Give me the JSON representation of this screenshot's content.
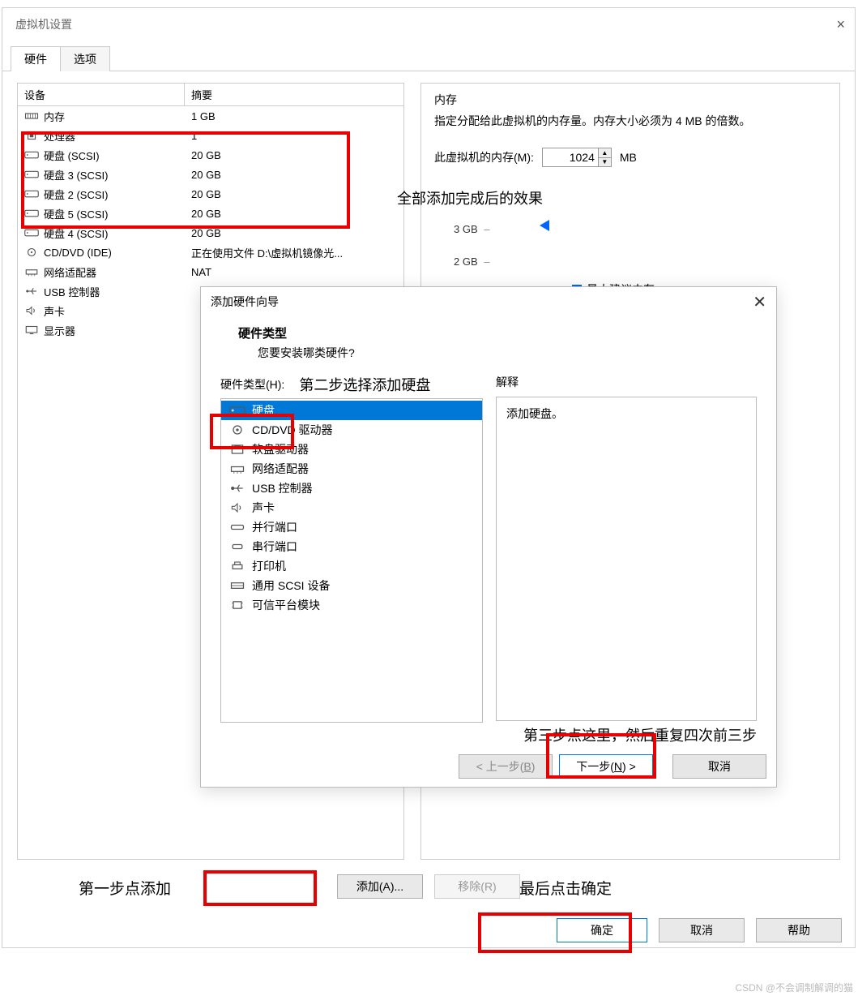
{
  "window": {
    "title": "虚拟机设置",
    "tabs": {
      "hardware": "硬件",
      "options": "选项"
    }
  },
  "devices": {
    "header": {
      "device": "设备",
      "summary": "摘要"
    },
    "rows": [
      {
        "name": "内存",
        "summary": "1 GB",
        "icon": "memory"
      },
      {
        "name": "处理器",
        "summary": "1",
        "icon": "cpu"
      },
      {
        "name": "硬盘 (SCSI)",
        "summary": "20 GB",
        "icon": "disk"
      },
      {
        "name": "硬盘 3 (SCSI)",
        "summary": "20 GB",
        "icon": "disk"
      },
      {
        "name": "硬盘 2 (SCSI)",
        "summary": "20 GB",
        "icon": "disk"
      },
      {
        "name": "硬盘 5 (SCSI)",
        "summary": "20 GB",
        "icon": "disk"
      },
      {
        "name": "硬盘 4 (SCSI)",
        "summary": "20 GB",
        "icon": "disk"
      },
      {
        "name": "CD/DVD (IDE)",
        "summary": "正在使用文件 D:\\虚拟机镜像光...",
        "icon": "cd"
      },
      {
        "name": "网络适配器",
        "summary": "NAT",
        "icon": "net"
      },
      {
        "name": "USB 控制器",
        "summary": "",
        "icon": "usb"
      },
      {
        "name": "声卡",
        "summary": "",
        "icon": "sound"
      },
      {
        "name": "显示器",
        "summary": "",
        "icon": "display"
      }
    ]
  },
  "memory": {
    "title": "内存",
    "desc": "指定分配给此虚拟机的内存量。内存大小必须为 4 MB 的倍数。",
    "label": "此虚拟机的内存(M):",
    "value": "1024",
    "unit": "MB",
    "effect_label": "全部添加完成后的效果",
    "scale": [
      "3 GB",
      "2 GB"
    ],
    "recommended_label": "最大建议内存"
  },
  "wizard": {
    "title": "添加硬件向导",
    "heading": "硬件类型",
    "subheading": "您要安装哪类硬件?",
    "type_label": "硬件类型(H):",
    "step2": "第二步选择添加硬盘",
    "items": [
      {
        "name": "硬盘",
        "icon": "disk",
        "selected": true
      },
      {
        "name": "CD/DVD 驱动器",
        "icon": "cd"
      },
      {
        "name": "软盘驱动器",
        "icon": "floppy"
      },
      {
        "name": "网络适配器",
        "icon": "net"
      },
      {
        "name": "USB 控制器",
        "icon": "usb"
      },
      {
        "name": "声卡",
        "icon": "sound"
      },
      {
        "name": "并行端口",
        "icon": "parallel"
      },
      {
        "name": "串行端口",
        "icon": "serial"
      },
      {
        "name": "打印机",
        "icon": "printer"
      },
      {
        "name": "通用 SCSI 设备",
        "icon": "scsi"
      },
      {
        "name": "可信平台模块",
        "icon": "tpm"
      }
    ],
    "explain_label": "解释",
    "explain_text": "添加硬盘。",
    "step3": "第三步点这里，然后重复四次前三步",
    "buttons": {
      "back": "< 上一步(B)",
      "next": "下一步(N) >",
      "cancel": "取消"
    }
  },
  "main_buttons": {
    "add": "添加(A)...",
    "remove": "移除(R)",
    "step1": "第一步点添加",
    "step4": "最后点击确定",
    "ok": "确定",
    "cancel": "取消",
    "help": "帮助"
  },
  "watermark": "CSDN @不会调制解调的猫"
}
